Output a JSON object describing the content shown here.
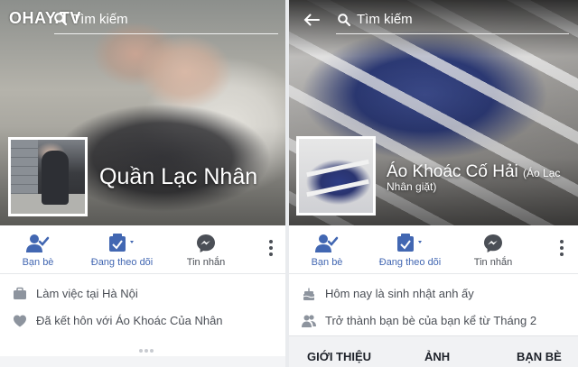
{
  "watermark": {
    "logo_text": "OHAY.TV"
  },
  "left_profile": {
    "search_placeholder": "Tìm kiếm",
    "name": "Quần Lạc Nhân",
    "actions": [
      {
        "label": "Bạn bè",
        "icon": "friends-check-icon"
      },
      {
        "label": "Đang theo dõi",
        "icon": "following-icon"
      },
      {
        "label": "Tin nhắn",
        "icon": "messenger-icon"
      }
    ],
    "info": [
      {
        "icon": "briefcase-icon",
        "text": "Làm việc tại Hà Nội"
      },
      {
        "icon": "heart-icon",
        "text": "Đã kết hôn với Áo Khoác Của Nhân"
      }
    ]
  },
  "right_profile": {
    "search_placeholder": "Tìm kiếm",
    "name_main": "Áo Khoác Cố Hải",
    "name_paren_1": "(Áo Lạc",
    "name_paren_2": "Nhân giặt)",
    "actions": [
      {
        "label": "Bạn bè",
        "icon": "friends-check-icon"
      },
      {
        "label": "Đang theo dõi",
        "icon": "following-icon"
      },
      {
        "label": "Tin nhắn",
        "icon": "messenger-icon"
      }
    ],
    "info": [
      {
        "icon": "birthday-cake-icon",
        "text": "Hôm nay là sinh nhật anh ấy"
      },
      {
        "icon": "friends-icon",
        "text": "Trở thành bạn bè của bạn kể từ Tháng 2"
      }
    ],
    "tabs": [
      "GIỚI THIỆU",
      "ẢNH",
      "BẠN BÈ"
    ]
  },
  "colors": {
    "fb_blue": "#4267b2",
    "text_gray": "#4b4f56",
    "divider": "#e9ebee"
  }
}
